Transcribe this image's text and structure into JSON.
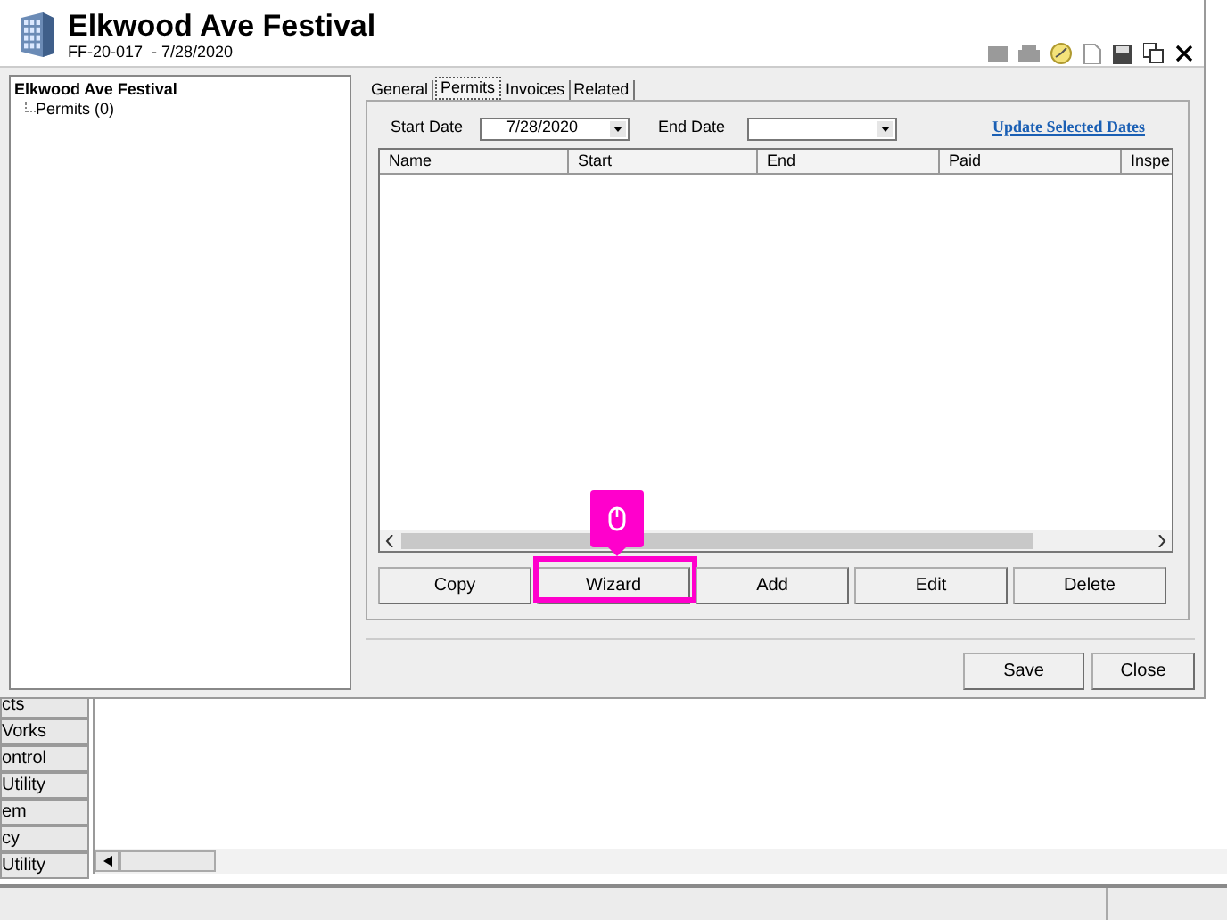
{
  "window": {
    "title": "Elkwood Ave Festival",
    "subtitle": "FF-20-017  - 7/28/2020"
  },
  "tree": [
    {
      "label": "Elkwood Ave Festival",
      "children": [
        {
          "label": "Permits (0)"
        }
      ]
    }
  ],
  "tabs": [
    {
      "label": "General",
      "selected": false
    },
    {
      "label": "Permits",
      "selected": true
    },
    {
      "label": "Invoices",
      "selected": false
    },
    {
      "label": "Related",
      "selected": false
    }
  ],
  "filters": {
    "start_label": "Start Date",
    "start_value": "7/28/2020",
    "end_label": "End Date",
    "update_link": "Update Selected Dates"
  },
  "table": {
    "columns": [
      "Name",
      "Start",
      "End",
      "Paid",
      "Inspe"
    ]
  },
  "actions": [
    {
      "label": "Copy",
      "highlighted": false
    },
    {
      "label": "Wizard",
      "highlighted": true
    },
    {
      "label": "Add",
      "highlighted": false
    },
    {
      "label": "Edit",
      "highlighted": false
    },
    {
      "label": "Delete",
      "highlighted": false
    }
  ],
  "footer_buttons": [
    "Save",
    "Close"
  ],
  "background_app": {
    "nav_items": [
      "cts",
      "Vorks",
      "ontrol",
      "Utility",
      "em",
      "cy",
      "Utility"
    ]
  }
}
